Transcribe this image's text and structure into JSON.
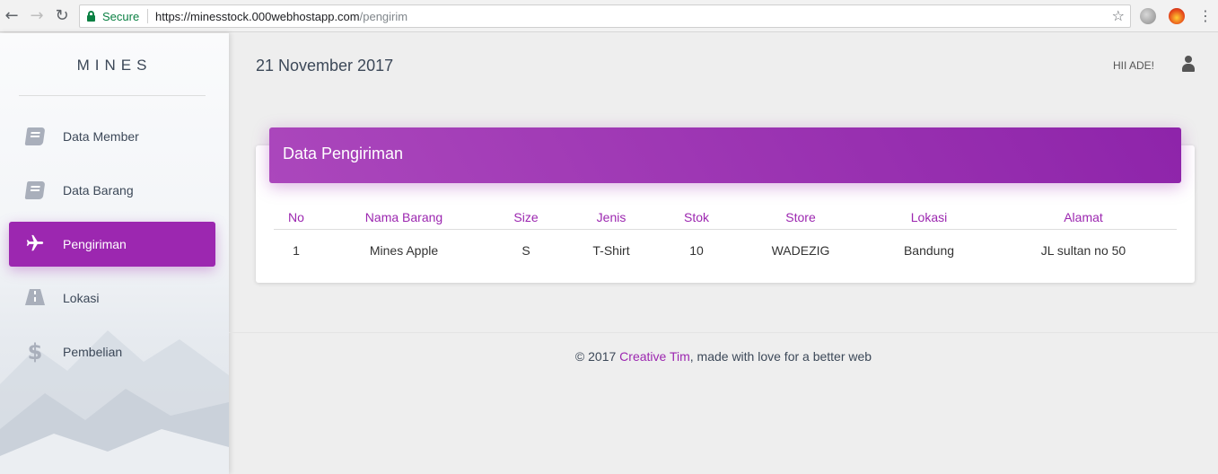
{
  "browser": {
    "secure_label": "Secure",
    "url_base": "https://minesstock.000webhostapp.com",
    "url_path": "/pengirim"
  },
  "sidebar": {
    "brand": "MINES",
    "items": [
      {
        "label": "Data Member",
        "icon": "book-icon"
      },
      {
        "label": "Data Barang",
        "icon": "book-icon"
      },
      {
        "label": "Pengiriman",
        "icon": "plane-icon",
        "active": true
      },
      {
        "label": "Lokasi",
        "icon": "road-icon"
      },
      {
        "label": "Pembelian",
        "icon": "dollar-icon"
      }
    ]
  },
  "header": {
    "date": "21 November 2017",
    "greeting": "HII ADE!"
  },
  "card": {
    "title": "Data Pengiriman",
    "columns": [
      "No",
      "Nama Barang",
      "Size",
      "Jenis",
      "Stok",
      "Store",
      "Lokasi",
      "Alamat"
    ],
    "rows": [
      [
        "1",
        "Mines Apple",
        "S",
        "T-Shirt",
        "10",
        "WADEZIG",
        "Bandung",
        "JL sultan no 50"
      ]
    ]
  },
  "footer": {
    "prefix": "© 2017 ",
    "link": "Creative Tim",
    "suffix": ", made with love for a better web"
  },
  "colors": {
    "accent": "#9c27b0",
    "secure": "#0b8043"
  }
}
